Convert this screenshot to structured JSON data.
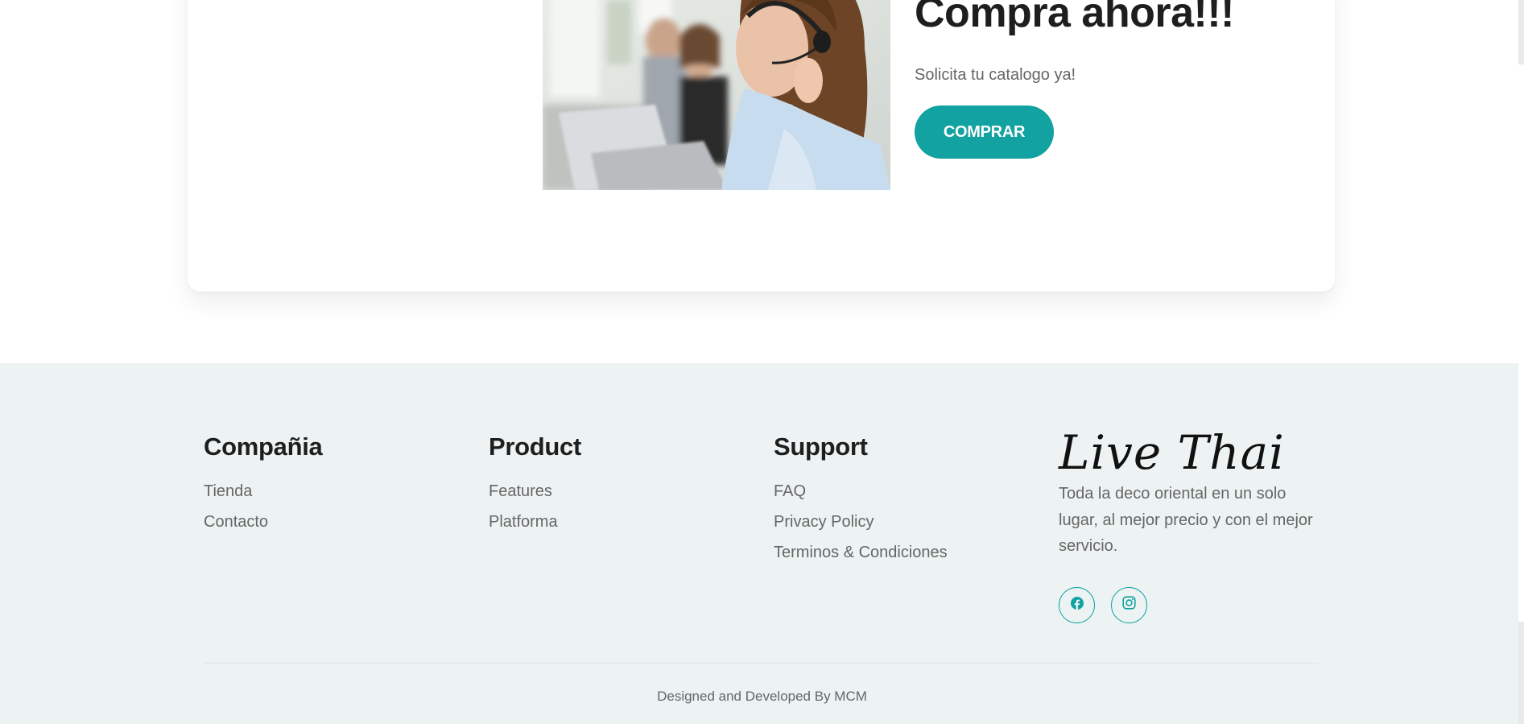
{
  "cta": {
    "title": "Compra ahora!!!",
    "subtitle": "Solicita tu catalogo ya!",
    "button_label": "COMPRAR",
    "image_subject": "call-center-agents"
  },
  "footer": {
    "columns": [
      {
        "title": "Compañia",
        "links": [
          "Tienda",
          "Contacto"
        ]
      },
      {
        "title": "Product",
        "links": [
          "Features",
          "Platforma"
        ]
      },
      {
        "title": "Support",
        "links": [
          "FAQ",
          "Privacy Policy",
          "Terminos & Condiciones"
        ]
      }
    ],
    "brand": {
      "logo_text": "Live Thai",
      "description": "Toda la deco oriental en un solo lugar, al mejor precio y con el mejor servicio."
    },
    "socials": [
      {
        "icon": "facebook-icon"
      },
      {
        "icon": "instagram-icon"
      }
    ],
    "copyright": "Designed and Developed By MCM"
  },
  "colors": {
    "accent": "#11a2a1",
    "footer_bg": "#edf3f3",
    "heading": "#1e1e1e",
    "body_text": "#666666"
  }
}
